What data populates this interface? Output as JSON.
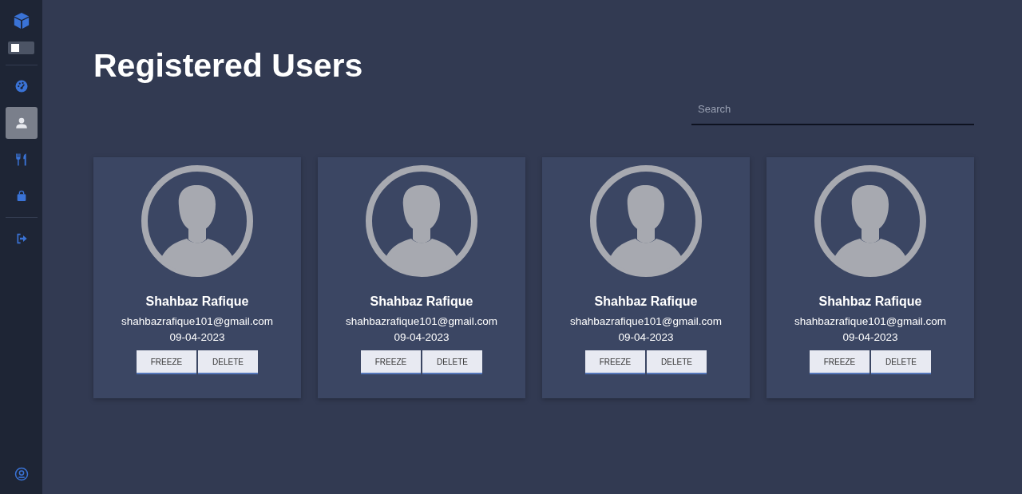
{
  "sidebar": {
    "theme_toggle": {
      "on": false
    },
    "nav_groups": [
      [
        {
          "kind": "dashboard",
          "selected": false
        },
        {
          "kind": "user",
          "selected": true
        },
        {
          "kind": "dining",
          "selected": false
        },
        {
          "kind": "bag",
          "selected": false
        }
      ],
      [
        {
          "kind": "logout",
          "selected": false
        }
      ]
    ]
  },
  "page": {
    "title": "Registered Users",
    "search": {
      "placeholder": "Search"
    }
  },
  "users": [
    {
      "name": "Shahbaz Rafique",
      "email": "shahbazrafique101@gmail.com",
      "date": "09-04-2023",
      "buttons": [
        "FREEZE",
        "DELETE"
      ]
    },
    {
      "name": "Shahbaz Rafique",
      "email": "shahbazrafique101@gmail.com",
      "date": "09-04-2023",
      "buttons": [
        "FREEZE",
        "DELETE"
      ]
    },
    {
      "name": "Shahbaz Rafique",
      "email": "shahbazrafique101@gmail.com",
      "date": "09-04-2023",
      "buttons": [
        "FREEZE",
        "DELETE"
      ]
    },
    {
      "name": "Shahbaz Rafique",
      "email": "shahbazrafique101@gmail.com",
      "date": "09-04-2023",
      "buttons": [
        "FREEZE",
        "DELETE"
      ]
    }
  ]
}
